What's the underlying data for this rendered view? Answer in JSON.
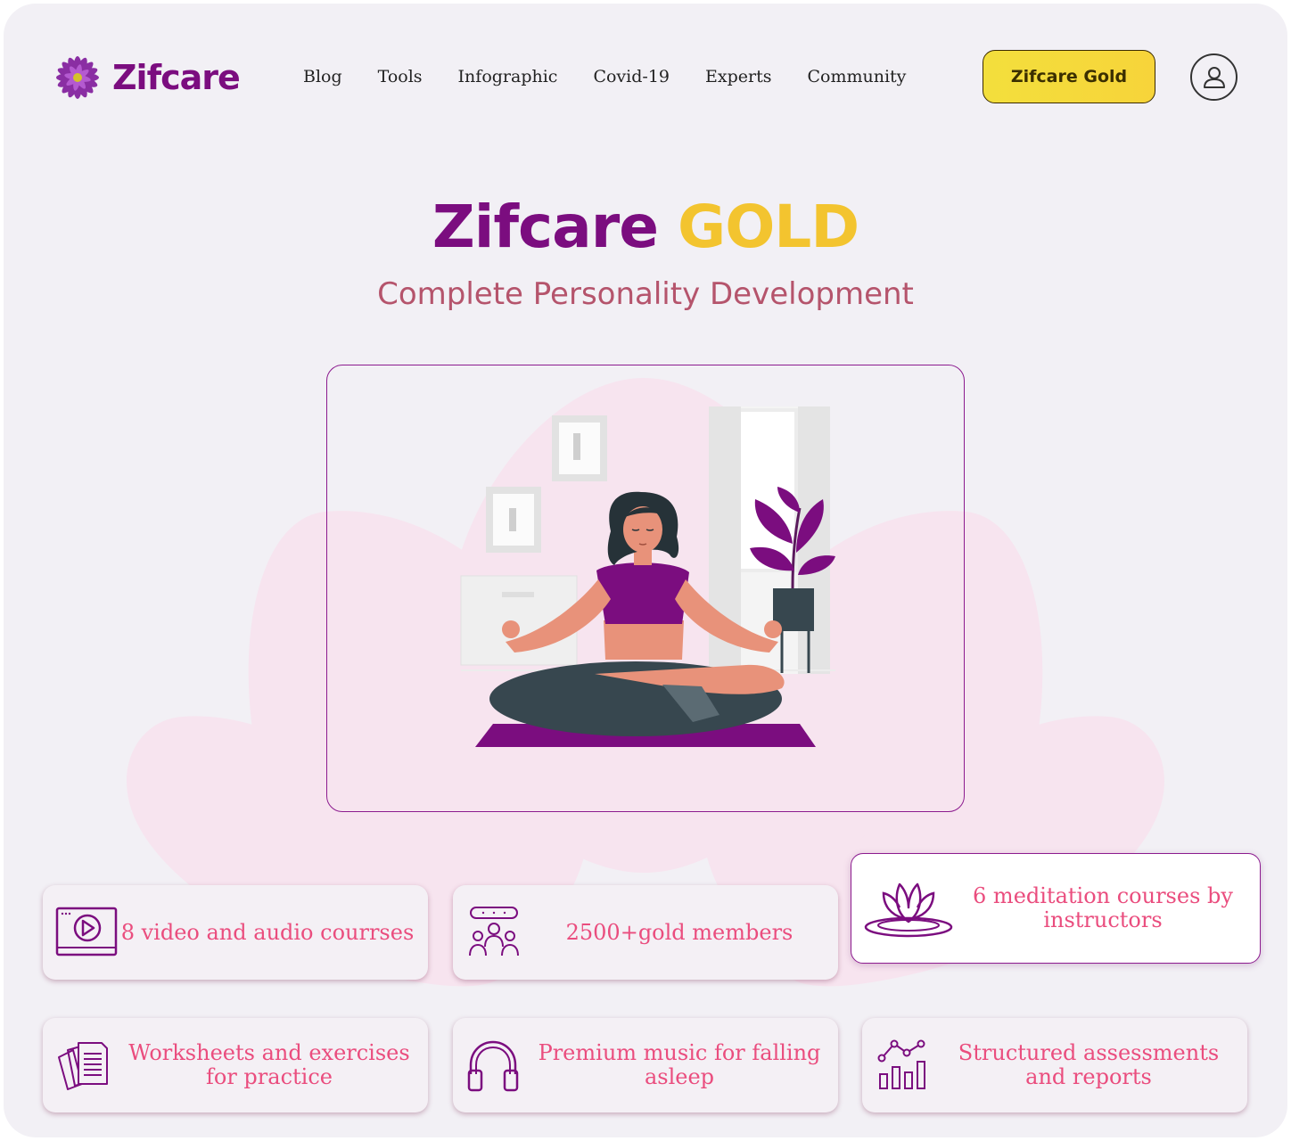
{
  "brand": {
    "name": "Zifcare",
    "logo_icon": "purple-flower-icon"
  },
  "nav": {
    "items": [
      "Blog",
      "Tools",
      "Infographic",
      "Covid-19",
      "Experts",
      "Community"
    ]
  },
  "header": {
    "gold_button_label": "Zifcare Gold",
    "profile_icon": "user-icon"
  },
  "hero": {
    "title_brand": "Zifcare",
    "title_gold": "GOLD",
    "subtitle": "Complete Personality Development",
    "illustration": "meditating-woman-illustration"
  },
  "features": [
    {
      "icon": "video-play-icon",
      "label": "8 video and audio courrses"
    },
    {
      "icon": "group-members-icon",
      "label": "2500+gold members"
    },
    {
      "icon": "lotus-icon",
      "label": "6 meditation courses by instructors"
    },
    {
      "icon": "worksheets-icon",
      "label": "Worksheets and exercises for practice"
    },
    {
      "icon": "headphones-icon",
      "label": "Premium music for falling asleep"
    },
    {
      "icon": "chart-report-icon",
      "label": "Structured assessments and reports"
    }
  ],
  "colors": {
    "brand": "#7b0d7f",
    "gold": "#f3c42f",
    "subtitle": "#b5546c",
    "feature_text": "#ea4d7e",
    "background": "#f2f0f5"
  }
}
